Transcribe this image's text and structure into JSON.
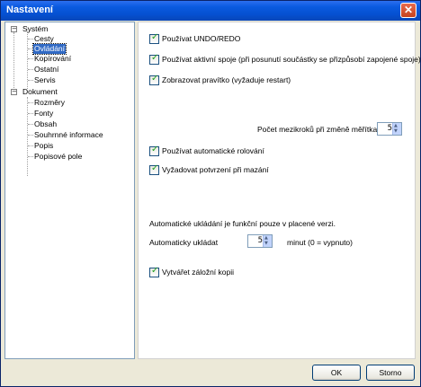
{
  "window": {
    "title": "Nastavení"
  },
  "tree": {
    "groups": [
      {
        "label": "Systém",
        "children": [
          "Cesty",
          "Ovládání",
          "Kopírování",
          "Ostatní",
          "Servis"
        ]
      },
      {
        "label": "Dokument",
        "children": [
          "Rozměry",
          "Fonty",
          "Obsah",
          "Souhrnné informace",
          "Popis",
          "Popisové pole"
        ]
      }
    ]
  },
  "options": {
    "undo": "Používat UNDO/REDO",
    "active_joints": "Používat aktivní spoje (při posunutí součástky se  přizpůsobí zapojené spoje)",
    "ruler": "Zobrazovat pravítko (vyžaduje restart)",
    "zoom_steps_label": "Počet mezikroků při změně měřítka:",
    "zoom_steps_value": "5",
    "auto_scroll": "Používat automatické rolování",
    "confirm_delete": "Vyžadovat potvrzení při mazání",
    "autosave_note": "Automatické ukládání je funkční pouze v placené verzi.",
    "autosave_label": "Automaticky ukládat",
    "autosave_value": "5",
    "autosave_unit": "minut   (0 = vypnuto)",
    "backup": "Vytvářet záložní kopii"
  },
  "buttons": {
    "ok": "OK",
    "cancel": "Storno"
  }
}
